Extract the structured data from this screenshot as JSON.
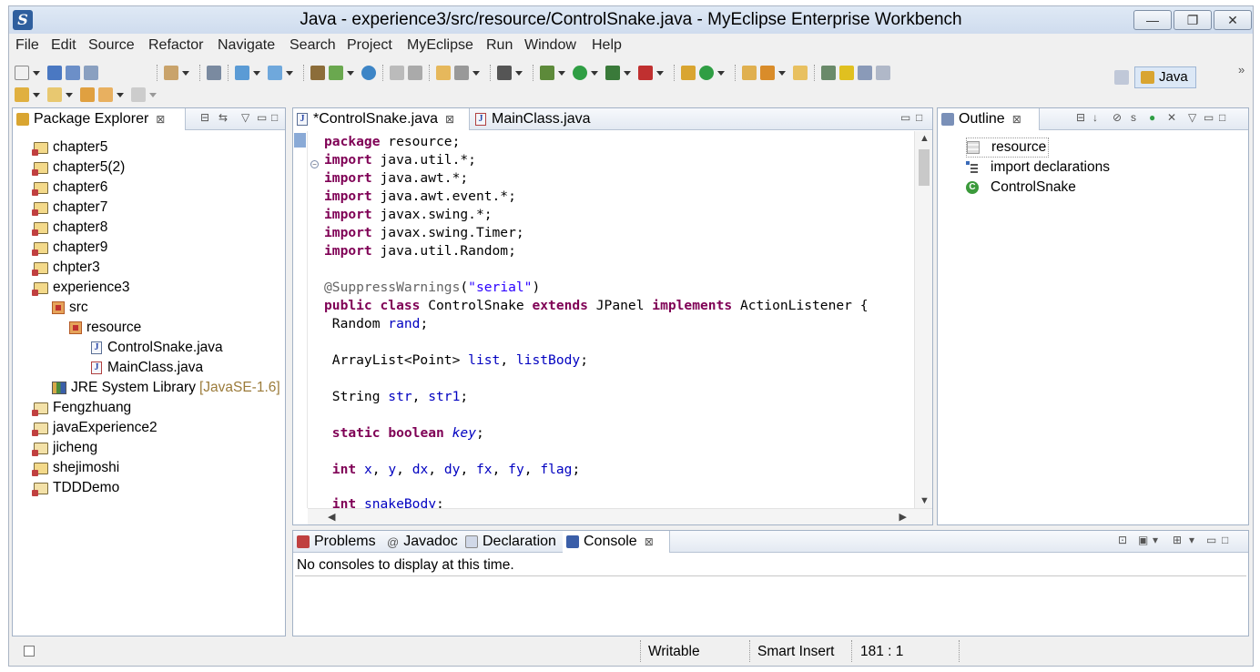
{
  "window": {
    "title": "Java - experience3/src/resource/ControlSnake.java - MyEclipse Enterprise Workbench",
    "app_icon": "myeclipse-logo",
    "buttons": {
      "minimize": "—",
      "maximize": "❐",
      "close": "✕"
    }
  },
  "menu": [
    "File",
    "Edit",
    "Source",
    "Refactor",
    "Navigate",
    "Search",
    "Project",
    "MyEclipse",
    "Run",
    "Window",
    "Help"
  ],
  "perspective": {
    "label": "Java",
    "chevron": "»"
  },
  "package_explorer": {
    "title": "Package Explorer",
    "items": [
      {
        "label": "chapter5",
        "type": "project"
      },
      {
        "label": "chapter5(2)",
        "type": "project"
      },
      {
        "label": "chapter6",
        "type": "project"
      },
      {
        "label": "chapter7",
        "type": "project"
      },
      {
        "label": "chapter8",
        "type": "project"
      },
      {
        "label": "chapter9",
        "type": "project"
      },
      {
        "label": "chpter3",
        "type": "project"
      },
      {
        "label": "experience3",
        "type": "project"
      },
      {
        "label": "src",
        "type": "source-folder"
      },
      {
        "label": "resource",
        "type": "package"
      },
      {
        "label": "ControlSnake.java",
        "type": "java-file"
      },
      {
        "label": "MainClass.java",
        "type": "java-file"
      },
      {
        "label": "JRE System Library",
        "version": "[JavaSE-1.6]",
        "type": "library"
      },
      {
        "label": "Fengzhuang",
        "type": "project"
      },
      {
        "label": "javaExperience2",
        "type": "project"
      },
      {
        "label": "jicheng",
        "type": "project"
      },
      {
        "label": "shejimoshi",
        "type": "project"
      },
      {
        "label": "TDDDemo",
        "type": "project"
      }
    ]
  },
  "editor": {
    "tabs": [
      {
        "label": "*ControlSnake.java",
        "active": true
      },
      {
        "label": "MainClass.java",
        "active": false
      }
    ]
  },
  "outline": {
    "title": "Outline",
    "items": [
      {
        "label": "resource",
        "icon": "package-icon"
      },
      {
        "label": "import declarations",
        "icon": "imports-icon"
      },
      {
        "label": "ControlSnake",
        "icon": "class-icon"
      }
    ]
  },
  "bottom_panel": {
    "tabs": [
      "Problems",
      "Javadoc",
      "Declaration",
      "Console"
    ],
    "active_tab": "Console",
    "message": "No consoles to display at this time."
  },
  "status": {
    "mode": "Writable",
    "insert": "Smart Insert",
    "position": "181 : 1"
  }
}
